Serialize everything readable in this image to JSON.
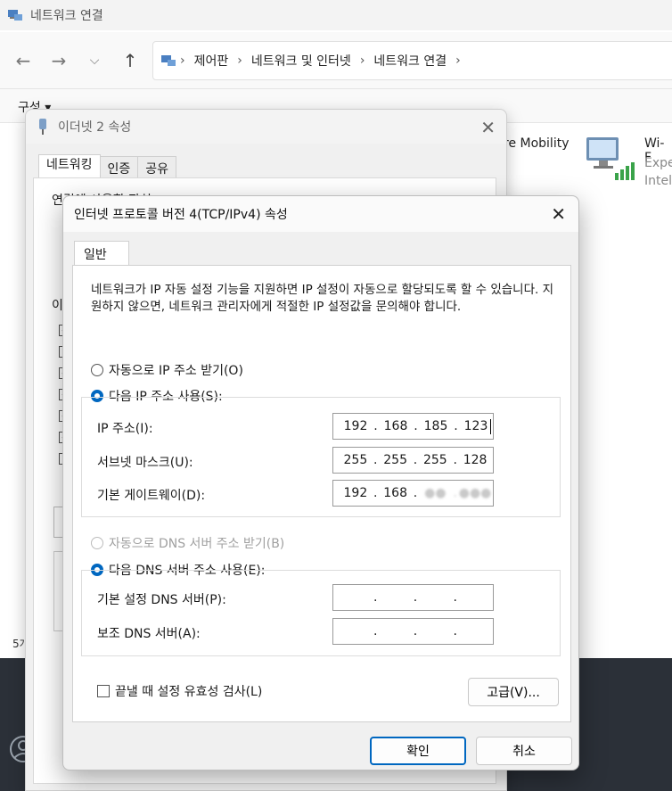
{
  "explorer": {
    "window_title": "네트워크 연결",
    "breadcrumb": [
      "제어판",
      "네트워크 및 인터넷",
      "네트워크 연결"
    ],
    "command_label": "구성",
    "status_count": "5개",
    "connections": [
      {
        "name": "re Mobility"
      },
      {
        "name": "Wi-F",
        "sub1": "Expe",
        "sub2": "Intel"
      }
    ]
  },
  "ethernet_dialog": {
    "title": "이더넷 2 속성",
    "tabs": [
      "네트워킹",
      "인증",
      "공유"
    ],
    "connect_using_label": "연결에 사용할 장치",
    "items_label": "이",
    "checkboxes": [
      true,
      false,
      true,
      true,
      true,
      true,
      false
    ]
  },
  "ipv4_dialog": {
    "title": "인터넷 프로토콜 버전 4(TCP/IPv4) 속성",
    "tab": "일반",
    "description": "네트워크가 IP 자동 설정 기능을 지원하면 IP 설정이 자동으로 할당되도록 할 수 있습니다. 지원하지 않으면, 네트워크 관리자에게 적절한 IP 설정값을 문의해야 합니다.",
    "auto_ip_label": "자동으로 IP 주소 받기(O)",
    "manual_ip_label": "다음 IP 주소 사용(S):",
    "ip_label": "IP 주소(I):",
    "ip_value": [
      "192",
      "168",
      "185",
      "123"
    ],
    "subnet_label": "서브넷 마스크(U):",
    "subnet_value": [
      "255",
      "255",
      "255",
      "128"
    ],
    "gateway_label": "기본 게이트웨이(D):",
    "gateway_value": [
      "192",
      "168",
      "●●",
      "●●●"
    ],
    "auto_dns_label": "자동으로 DNS 서버 주소 받기(B)",
    "manual_dns_label": "다음 DNS 서버 주소 사용(E):",
    "preferred_dns_label": "기본 설정 DNS 서버(P):",
    "preferred_dns_value": [
      "",
      "",
      "",
      ""
    ],
    "alternate_dns_label": "보조 DNS 서버(A):",
    "alternate_dns_value": [
      "",
      "",
      "",
      ""
    ],
    "validate_label": "끝낼 때 설정 유효성 검사(L)",
    "advanced_button": "고급(V)...",
    "ok_button": "확인",
    "cancel_button": "취소",
    "selected_ip_mode": "manual",
    "selected_dns_mode": "manual"
  },
  "colors": {
    "accent": "#0067c0",
    "dialog_bg": "#f0f0f0",
    "desktop": "#2b3038"
  }
}
